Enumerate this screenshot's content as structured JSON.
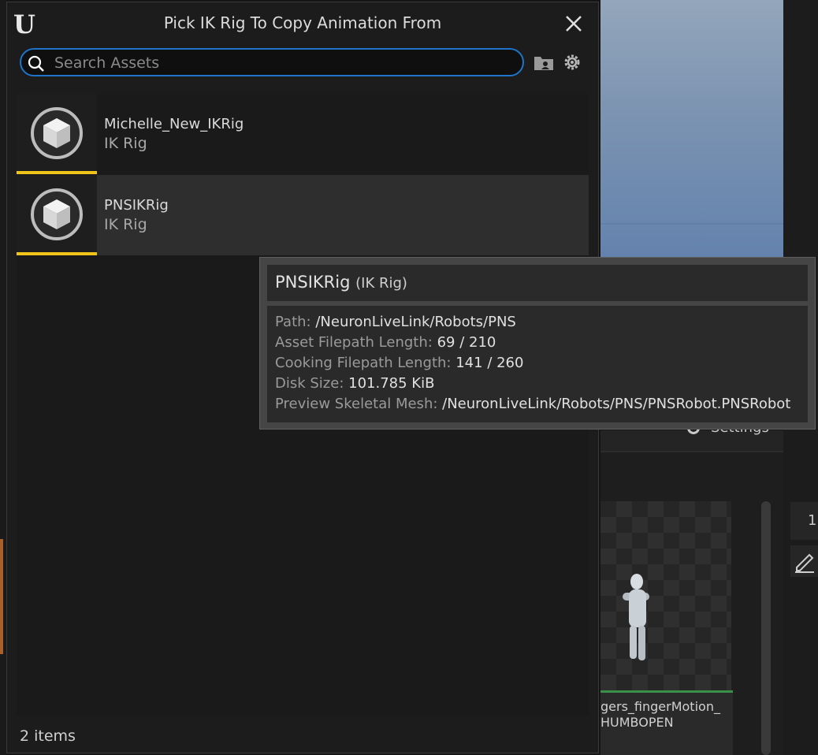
{
  "dialog": {
    "title": "Pick IK Rig To Copy Animation From",
    "search_placeholder": "Search Assets",
    "status": "2 items"
  },
  "assets": [
    {
      "name": "Michelle_New_IKRig",
      "type": "IK Rig"
    },
    {
      "name": "PNSIKRig",
      "type": "IK Rig"
    }
  ],
  "tooltip": {
    "name": "PNSIKRig",
    "type_label": "(IK Rig)",
    "rows": [
      {
        "key": "Path:",
        "value": "/NeuronLiveLink/Robots/PNS"
      },
      {
        "key": "Asset Filepath Length:",
        "value": "69 / 210"
      },
      {
        "key": "Cooking Filepath Length:",
        "value": "141 / 260"
      },
      {
        "key": "Disk Size:",
        "value": "101.785 KiB"
      },
      {
        "key": "Preview Skeletal Mesh:",
        "value": "/NeuronLiveLink/Robots/PNS/PNSRobot.PNSRobot"
      }
    ]
  },
  "background": {
    "settings_label": "Settings",
    "thumb_label_line1": "gers_fingerMotion_",
    "thumb_label_line2": "HUMBOPEN",
    "right_cell_text": "1"
  },
  "colors": {
    "accent": "#1e74c8",
    "asset_bar": "#f0c419"
  }
}
